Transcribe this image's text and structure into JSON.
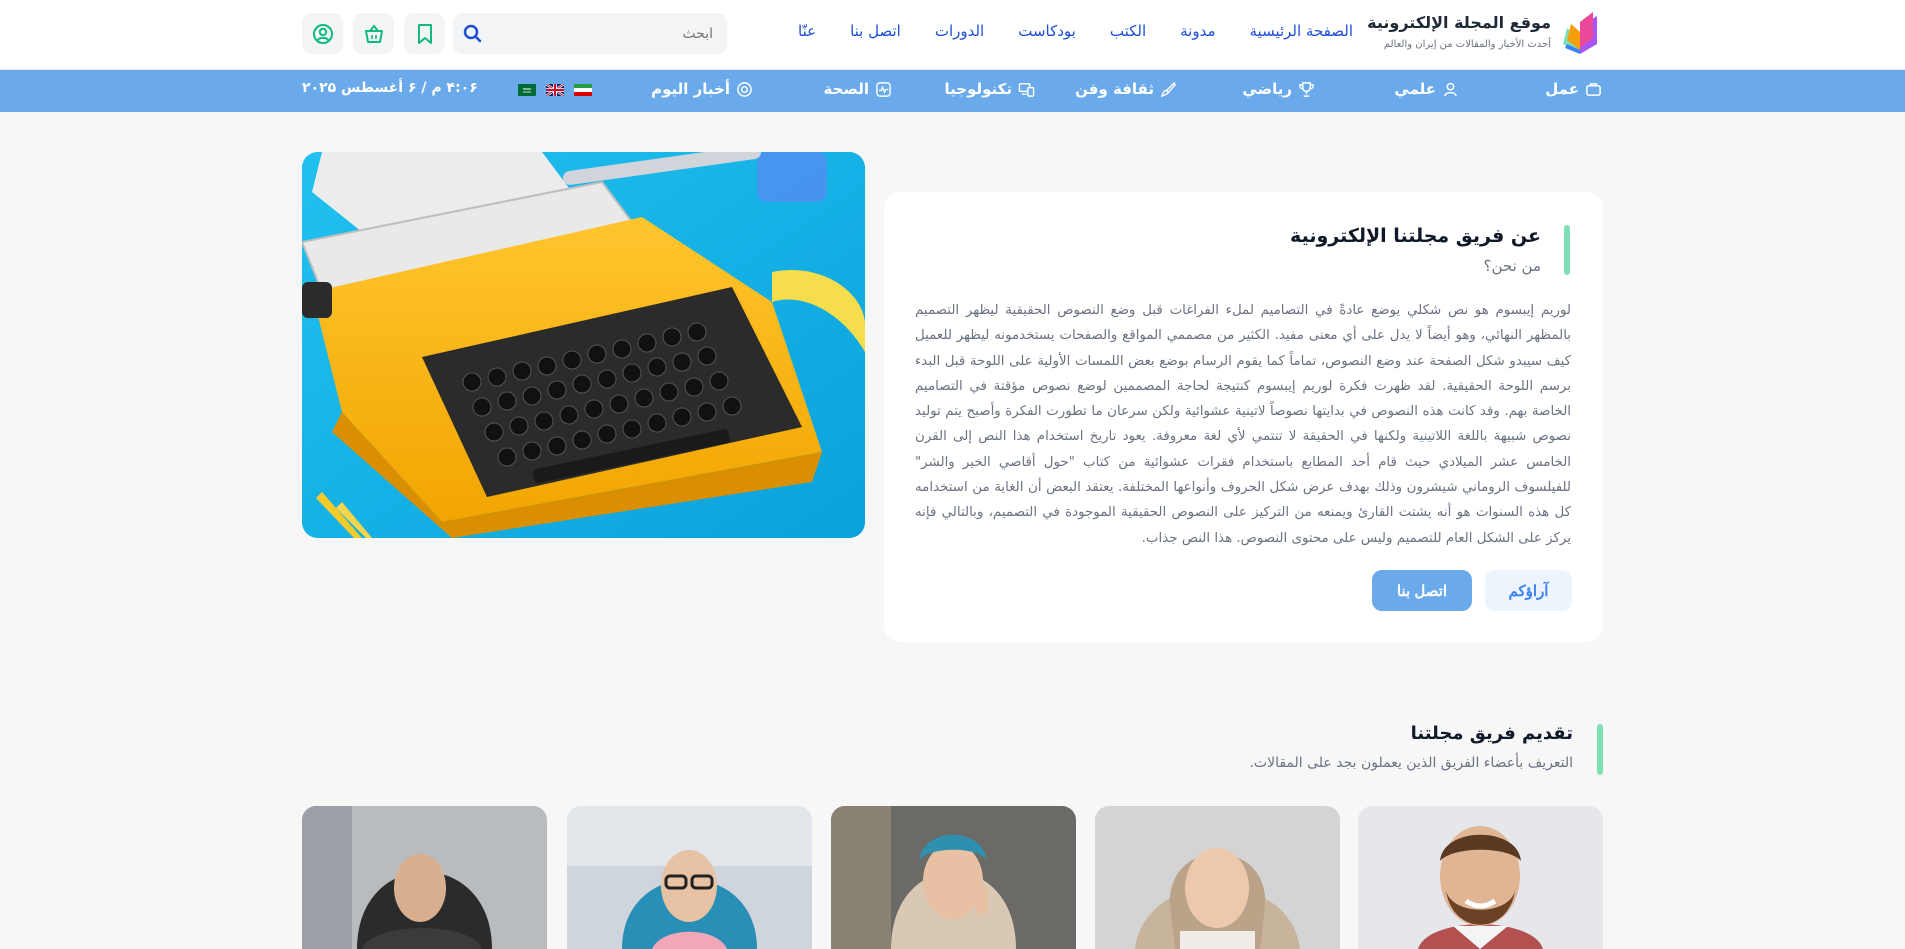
{
  "site": {
    "title": "موقع المجلة الإلكترونية",
    "tagline": "أحدث الأخبار والمقالات من إيران والعالم"
  },
  "nav": {
    "items": [
      {
        "label": "الصفحة الرئيسية"
      },
      {
        "label": "مدونة"
      },
      {
        "label": "الكتب"
      },
      {
        "label": "بودكاست"
      },
      {
        "label": "الدورات"
      },
      {
        "label": "اتصل بنا"
      },
      {
        "label": "عنّا"
      }
    ]
  },
  "search": {
    "placeholder": "ابحث"
  },
  "header_icons": [
    "search-icon",
    "bookmark-icon",
    "basket-icon",
    "user-icon"
  ],
  "categories": [
    {
      "label": "عمل",
      "icon": "briefcase-icon"
    },
    {
      "label": "علمي",
      "icon": "user-icon"
    },
    {
      "label": "رياضي",
      "icon": "trophy-icon"
    },
    {
      "label": "ثقافة وفن",
      "icon": "brush-icon"
    },
    {
      "label": "تكنولوجيا",
      "icon": "devices-icon"
    },
    {
      "label": "الصحة",
      "icon": "heart-monitor-icon"
    },
    {
      "label": "أخبار اليوم",
      "icon": "news-icon"
    }
  ],
  "languages": [
    "flag-saudi-icon",
    "flag-uk-icon",
    "flag-iran-icon"
  ],
  "datetime": "۴:۰۶ م / ۶ أغسطس ۲۰۲۵",
  "about": {
    "title": "عن فريق مجلتنا الإلكترونية",
    "subtitle": "من نحن؟",
    "body": "لوريم إيبسوم هو نص شكلي يوضع عادةً في التصاميم لملء الفراغات قبل وضع النصوص الحقيقية ليظهر التصميم بالمظهر النهائي، وهو أيضاً لا يدل على أي معنى مفيد. الكثير من مصممي المواقع والصفحات يستخدمونه ليظهر للعميل كيف سيبدو شكل الصفحة عند وضع النصوص، تماماً كما يقوم الرسام بوضع بعض اللمسات الأولية على اللوحة قبل البدء برسم اللوحة الحقيقية. لقد ظهرت فكرة لوريم إيبسوم كنتيجة لحاجة المصممين لوضع نصوص مؤقتة في التصاميم الخاصة بهم. وقد كانت هذه النصوص في بدايتها نصوصاً لاتينية عشوائية ولكن سرعان ما تطورت الفكرة وأصبح يتم توليد نصوص شبيهة باللغة اللاتينية ولكنها في الحقيقة لا تنتمي لأي لغة معروفة. يعود تاريخ استخدام هذا النص إلى القرن الخامس عشر الميلادي حيث قام أحد المطابع باستخدام فقرات عشوائية من كتاب \"حول أقاصي الخير والشر\" للفيلسوف الروماني شيشرون وذلك بهدف عرض شكل الحروف وأنواعها المختلفة. يعتقد البعض أن الغاية من استخدامه كل هذه السنوات هو أنه يشتت القارئ ويمنعه من التركيز على النصوص الحقيقية الموجودة في التصميم، وبالتالي فإنه يركز على الشكل العام للتصميم وليس على محتوى النصوص. هذا النص جذاب.",
    "contact_button": "اتصل بنا",
    "opinions_button": "آراؤكم"
  },
  "team": {
    "title": "تقديم فريق مجلتنا",
    "subtitle": "التعريف بأعضاء الفريق الذين يعملون بجد على المقالات."
  },
  "colors": {
    "primary": "#6aa9ea",
    "accent": "#7ee0b6",
    "nav_link": "#1d4ed8",
    "page_bg": "#f7f7f8"
  }
}
